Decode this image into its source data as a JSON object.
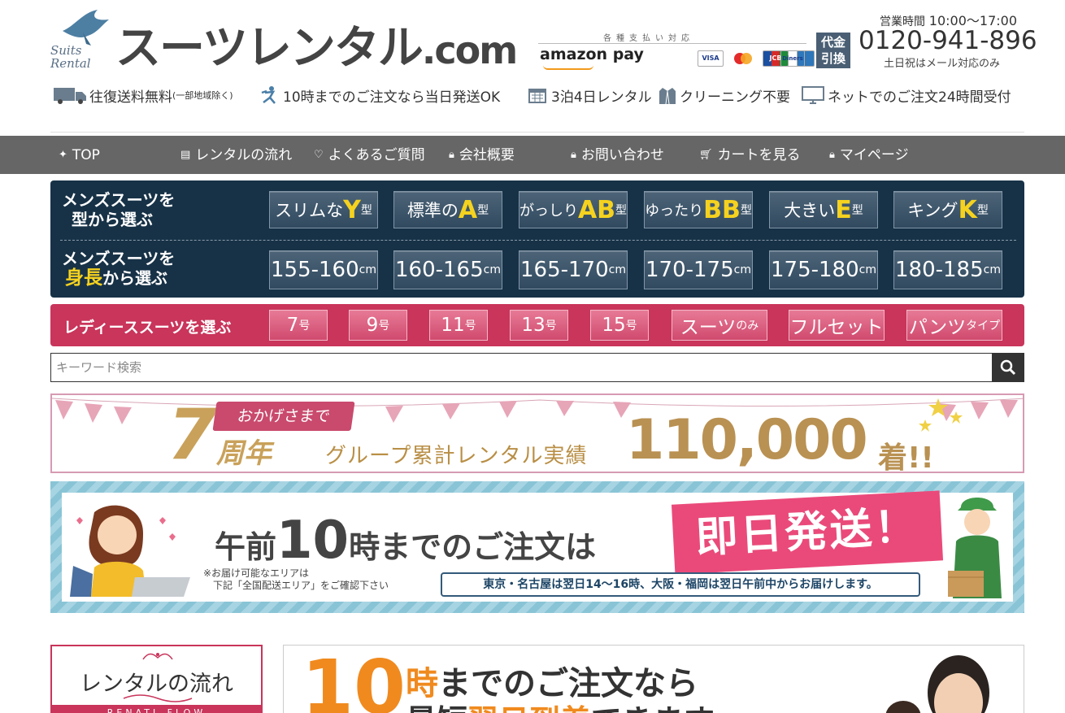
{
  "header": {
    "logo_script": "Suits\nRental",
    "logo_main": "スーツレンタル",
    "logo_dot": ".com",
    "payment_title": "各種支払い対応",
    "amazon_pay": "amazon pay",
    "cards": [
      "VISA",
      "MC",
      "JCB",
      "AMEX",
      "Diners"
    ],
    "cod": "代金\n引換",
    "hours_label": "営業時間",
    "hours_value": "10:00〜17:00",
    "phone": "0120-941-896",
    "phone_note": "土日祝はメール対応のみ",
    "features": [
      {
        "text": "往復送料無料",
        "small": "(一部地域除く)"
      },
      {
        "text": "10時までのご注文なら当日発送OK",
        "small": ""
      },
      {
        "text": "3泊4日レンタル",
        "small": ""
      },
      {
        "text": "クリーニング不要",
        "small": ""
      },
      {
        "text": "ネットでのご注文24時間受付",
        "small": ""
      }
    ]
  },
  "nav": [
    {
      "label": "TOP",
      "icon": "sparkle-icon"
    },
    {
      "label": "レンタルの流れ",
      "icon": "document-icon"
    },
    {
      "label": "よくあるご質問",
      "icon": "heart-icon"
    },
    {
      "label": "会社概要",
      "icon": "lock-icon"
    },
    {
      "label": "お問い合わせ",
      "icon": "lock-icon"
    },
    {
      "label": "カートを見る",
      "icon": "cart-icon"
    },
    {
      "label": "マイページ",
      "icon": "lock-icon"
    }
  ],
  "mens": {
    "type_label_1": "メンズスーツを",
    "type_label_2_a": "型",
    "type_label_2_b": "から選ぶ",
    "height_label_1": "メンズスーツを",
    "height_label_2_a": "身長",
    "height_label_2_b": "から選ぶ",
    "types": [
      {
        "pre": "スリムな",
        "big": "Y",
        "post": "型"
      },
      {
        "pre": "標準の",
        "big": "A",
        "post": "型"
      },
      {
        "pre": "がっしり",
        "big": "AB",
        "post": "型"
      },
      {
        "pre": "ゆったり",
        "big": "BB",
        "post": "型"
      },
      {
        "pre": "大きい",
        "big": "E",
        "post": "型"
      },
      {
        "pre": "キング",
        "big": "K",
        "post": "型"
      }
    ],
    "heights": [
      {
        "num": "155-160",
        "unit": "cm"
      },
      {
        "num": "160-165",
        "unit": "cm"
      },
      {
        "num": "165-170",
        "unit": "cm"
      },
      {
        "num": "170-175",
        "unit": "cm"
      },
      {
        "num": "175-180",
        "unit": "cm"
      },
      {
        "num": "180-185",
        "unit": "cm"
      }
    ]
  },
  "ladies": {
    "label": "レディーススーツを選ぶ",
    "buttons": [
      {
        "main": "7",
        "small": "号"
      },
      {
        "main": "9",
        "small": "号"
      },
      {
        "main": "11",
        "small": "号"
      },
      {
        "main": "13",
        "small": "号"
      },
      {
        "main": "15",
        "small": "号"
      },
      {
        "main": "スーツ",
        "small": "のみ"
      },
      {
        "main": "フルセット",
        "small": ""
      },
      {
        "main": "パンツ",
        "small": "タイプ"
      }
    ]
  },
  "search": {
    "placeholder": "キーワード検索"
  },
  "banner1": {
    "seven": "7",
    "okage": "おかげさまで",
    "anniv": "周年",
    "text": "グループ累計レンタル実績",
    "number": "110,000",
    "ki": "着!!"
  },
  "banner2": {
    "morning_a": "午前",
    "morning_ten": "10",
    "morning_b": "時までのご注文は",
    "same_day": "即日発送！",
    "note_1": "※お届け可能なエリアは",
    "note_2": "　下記「全国配送エリア」をご確認下さい",
    "delivery": "東京・名古屋は翌日14〜16時、大阪・福岡は翌日午前中からお届けします。"
  },
  "flow": {
    "title": "レンタルの流れ",
    "sub": "RENATL FLOW"
  },
  "promo": {
    "ten": "10",
    "line1_a": "時",
    "line1_b": "までのご注文なら",
    "line2_a": "最短",
    "line2_b": "翌日到着",
    "line2_c": "できます"
  },
  "colors": {
    "nav_bg": "#666666",
    "mens_bg": "#173247",
    "ladies_bg": "#c9355b",
    "accent_yellow": "#f5d21f"
  }
}
